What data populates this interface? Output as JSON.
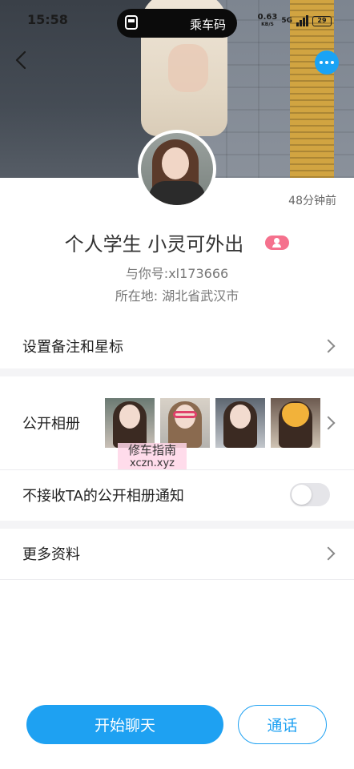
{
  "status_bar": {
    "time": "15:58",
    "pill_label": "乘车码",
    "net_speed": "0.63",
    "net_unit": "KB/S",
    "signal_label": "5G",
    "battery": "29"
  },
  "profile": {
    "time_ago": "48分钟前",
    "name": "个人学生 小灵可外出",
    "uid": "与你号:xl173666",
    "location": "所在地: 湖北省武汉市"
  },
  "rows": {
    "remark_label": "设置备注和星标",
    "album_label": "公开相册",
    "album_notify_label": "不接收TA的公开相册通知",
    "more_info_label": "更多资料"
  },
  "album_notify_toggle": {
    "on": false
  },
  "watermark": {
    "line1": "修车指南",
    "line2": "xczn.xyz"
  },
  "actions": {
    "chat_label": "开始聊天",
    "call_label": "通话"
  },
  "colors": {
    "accent": "#1ea1f2",
    "gender_badge": "#f5718d",
    "watermark_bg": "#ffd6e8"
  },
  "icons": {
    "back": "back-chevron-icon",
    "more": "more-dots-icon",
    "gender": "female-person-icon",
    "row_arrow": "chevron-right-icon"
  }
}
